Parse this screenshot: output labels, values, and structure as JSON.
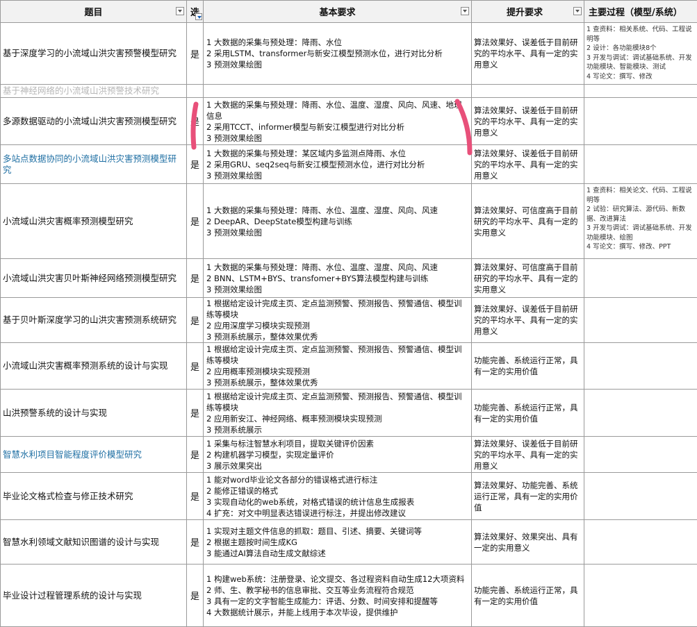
{
  "headers": {
    "topic": "题目",
    "selected": "选",
    "basic": "基本要求",
    "improve": "提升要求",
    "process": "主要过程（模型/系统）"
  },
  "rows": [
    {
      "topic": "基于深度学习的小流域山洪灾害预警模型研究",
      "selected": "是",
      "basic": [
        "1 大数据的采集与预处理：降雨、水位",
        "2 采用LSTM、transformer与新安江模型预测水位，进行对比分析",
        "3 预测效果绘图"
      ],
      "improve": "算法效果好、误差低于目前研究的平均水平、具有一定的实用意义",
      "process": [
        "1 查资料：相关系统、代码、工程说明等",
        "2 设计：各功能模块8个",
        "3 开发与调试：调试基础系统、开发功能模块、智能模块、测试",
        "4 写论文：撰写、修改"
      ]
    },
    {
      "topic": "基于神经网络的小流域山洪预警技术研究",
      "selected": "",
      "basic": [],
      "improve": "",
      "process": []
    },
    {
      "topic": "多源数据驱动的小流域山洪灾害预测模型研究",
      "selected": "是",
      "basic": [
        "1 大数据的采集与预处理：降雨、水位、温度、湿度、风向、风速、地理信息",
        "2 采用TCCT、informer模型与新安江模型进行对比分析",
        "3 预测效果绘图"
      ],
      "improve": "算法效果好、误差低于目前研究的平均水平、具有一定的实用意义",
      "process": []
    },
    {
      "topic": "多站点数据协同的小流域山洪灾害预测模型研究",
      "selected": "是",
      "basic": [
        "1 大数据的采集与预处理：某区域内多监测点降雨、水位",
        "2 采用GRU、seq2seq与新安江模型预测水位，进行对比分析",
        "3 预测效果绘图"
      ],
      "improve": "算法效果好、误差低于目前研究的平均水平、具有一定的实用意义",
      "process": []
    },
    {
      "topic": "小流域山洪灾害概率预测模型研究",
      "selected": "是",
      "basic": [
        "1 大数据的采集与预处理：降雨、水位、温度、湿度、风向、风速",
        "2 DeepAR、DeepState模型构建与训练",
        "3 预测效果绘图"
      ],
      "improve": "算法效果好、可信度高于目前研究的平均水平、具有一定的实用意义",
      "process": [
        "1 查资料：相关论文、代码、工程说明等",
        "2 试验：研究算法、源代码、新数据、改进算法",
        "3 开发与调试：调试基础系统、开发功能模块、绘图",
        "4 写论文：撰写、修改、PPT"
      ]
    },
    {
      "topic": "小流域山洪灾害贝叶斯神经网络预测模型研究",
      "selected": "是",
      "basic": [
        "1 大数据的采集与预处理：降雨、水位、温度、湿度、风向、风速",
        "2 BNN、LSTM+BYS、transfomer+BYS算法模型构建与训练",
        "3 预测效果绘图"
      ],
      "improve": "算法效果好、可信度高于目前研究的平均水平、具有一定的实用意义",
      "process": []
    },
    {
      "topic": "基于贝叶斯深度学习的山洪灾害预测系统研究",
      "selected": "是",
      "basic": [
        "1 根据给定设计完成主页、定点监测预警、预测报告、预警通信、模型训练等模块",
        "2 应用深度学习模块实现预测",
        "3 预测系统展示，整体效果优秀"
      ],
      "improve": "算法效果好、误差低于目前研究的平均水平、具有一定的实用意义",
      "process": []
    },
    {
      "topic": "小流域山洪灾害概率预测系统的设计与实现",
      "selected": "是",
      "basic": [
        "1 根据给定设计完成主页、定点监测预警、预测报告、预警通信、模型训练等模块",
        "2 应用概率预测模块实现预测",
        "3 预测系统展示，整体效果优秀"
      ],
      "improve": "功能完善、系统运行正常，具有一定的实用价值",
      "process": []
    },
    {
      "topic": "山洪预警系统的设计与实现",
      "selected": "是",
      "basic": [
        "1 根据给定设计完成主页、定点监测预警、预测报告、预警通信、模型训练等模块",
        "2 应用新安江、神经网络、概率预测模块实现预测",
        "3 预测系统展示"
      ],
      "improve": "功能完善、系统运行正常，具有一定的实用价值",
      "process": []
    },
    {
      "topic": "智慧水利项目智能程度评价模型研究",
      "selected": "是",
      "basic": [
        "1 采集与标注智慧水利项目，提取关键评价因素",
        "2 构建机器学习模型，实现定量评价",
        "3 展示效果突出"
      ],
      "improve": "算法效果好、误差低于目前研究的平均水平、具有一定的实用意义",
      "process": []
    },
    {
      "topic": "毕业论文格式检查与修正技术研究",
      "selected": "是",
      "basic": [
        "1 能对word毕业论文各部分的错误格式进行标注",
        "2 能修正错误的格式",
        "3 实现自动化的web系统，对格式错误的统计信息生成报表",
        "4 扩充：对文中明显表达错误进行标注，并提出修改建议"
      ],
      "improve": "算法效果好、功能完善、系统运行正常，具有一定的实用价值",
      "process": []
    },
    {
      "topic": "智慧水利领域文献知识图谱的设计与实现",
      "selected": "是",
      "basic": [
        "1 实现对主题文件信息的抓取：题目、引述、摘要、关键词等",
        "2 根据主题按时间生成KG",
        "3 能通过AI算法自动生成文献综述"
      ],
      "improve": "算法效果好、效果突出、具有一定的实用意义",
      "process": []
    },
    {
      "topic": "毕业设计过程管理系统的设计与实现",
      "selected": "是",
      "basic": [
        "1 构建web系统：注册登录、论文提交、各过程资料自动生成12大项资料",
        "2 师、生、教学秘书的信息审批、交互等业务流程符合规范",
        "3 具有一定的文字智能生成能力：评语、分数、时间安排和提醒等",
        "4 大数据统计展示，并能上线用于本次毕设，提供维护"
      ],
      "improve": "功能完善、系统运行正常，具有一定的实用价值",
      "process": []
    }
  ],
  "colors": {
    "header_bg": "#f2f2f2",
    "grid": "#9a9a9a",
    "link_blue": "#1f6fa3",
    "faint": "#b7b7b7",
    "marker": "#e8507a"
  }
}
